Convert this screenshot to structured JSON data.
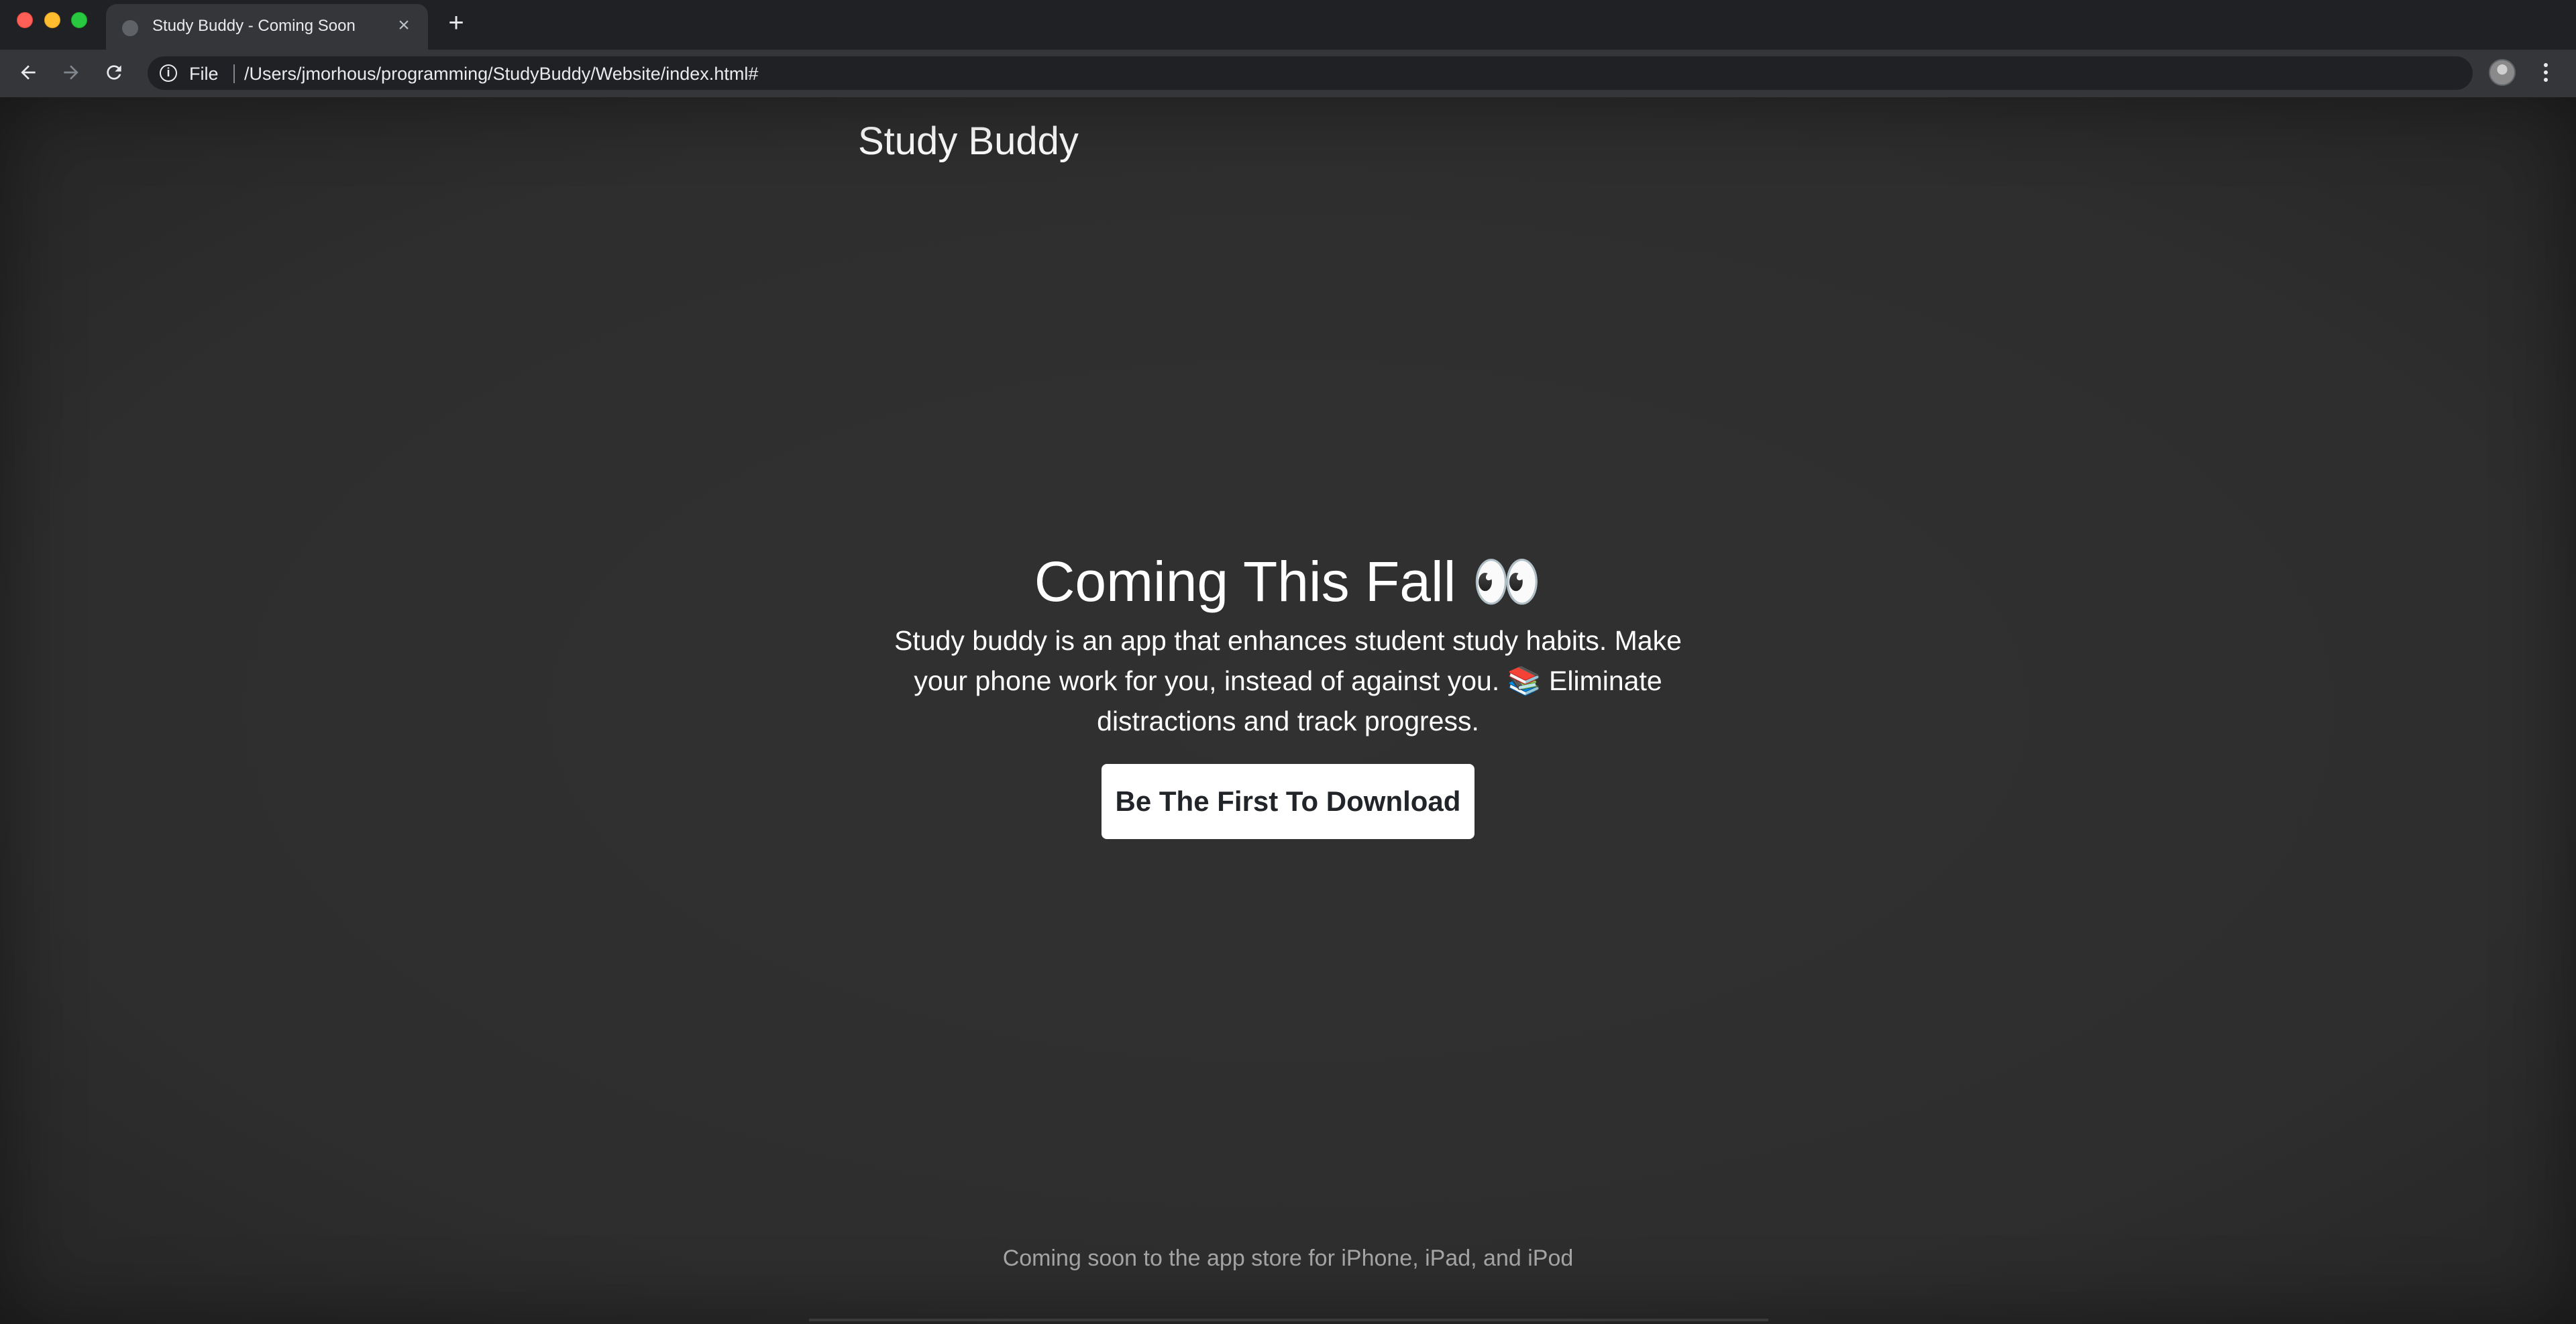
{
  "browser": {
    "tab": {
      "title": "Study Buddy - Coming Soon",
      "favicon": "globe-icon"
    },
    "new_tab_label": "+",
    "close_label": "×",
    "address": {
      "scheme_label": "File",
      "url": "/Users/jmorhous/programming/StudyBuddy/Website/index.html#"
    },
    "icons": {
      "back": "arrow-left-icon",
      "forward": "arrow-right-icon",
      "reload": "reload-icon",
      "info": "info-icon",
      "bookmark": "star-icon",
      "profile": "avatar",
      "menu": "kebab-menu-icon"
    }
  },
  "page": {
    "brand": "Study Buddy",
    "hero": {
      "title": "Coming This Fall 👀",
      "description": "Study buddy is an app that enhances student study habits. Make your phone work for you, instead of against you. 📚 Eliminate distractions and track progress.",
      "cta_label": "Be The First To Download"
    },
    "footer": "Coming soon to the app store for iPhone, iPad, and iPod"
  },
  "colors": {
    "chrome_bg": "#202124",
    "toolbar_bg": "#35363a",
    "page_bg": "#2f2f2f",
    "cta_bg": "#ffffff",
    "footer_text": "#a7a7a7"
  }
}
